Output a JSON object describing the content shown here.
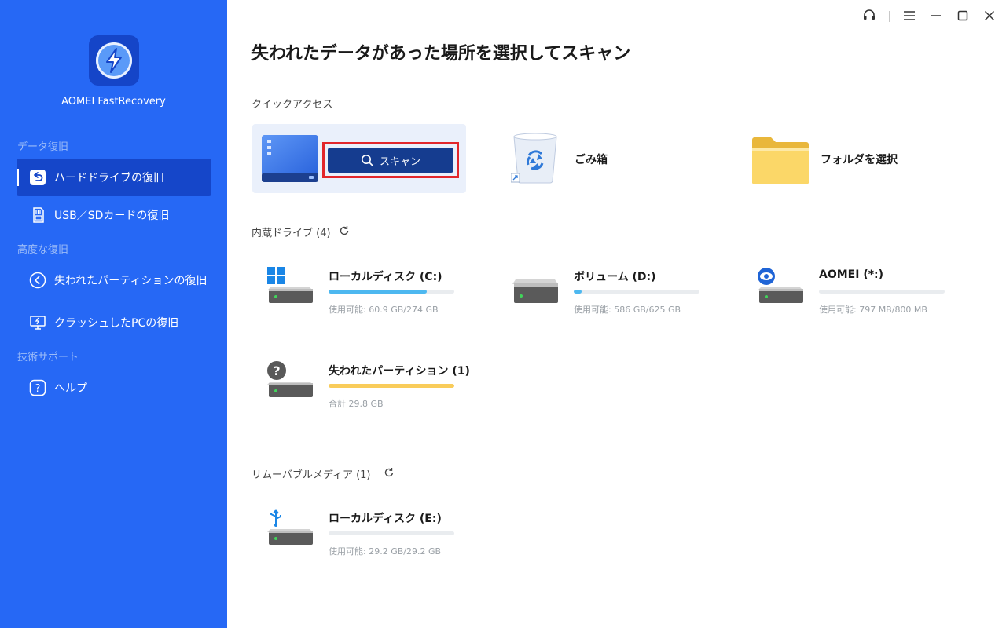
{
  "app": {
    "name": "AOMEI FastRecovery"
  },
  "sidebar": {
    "sections": {
      "data_recovery": "データ復旧",
      "advanced": "高度な復旧",
      "support": "技術サポート"
    },
    "items": [
      {
        "label": "ハードドライブの復旧",
        "icon": "undo-icon",
        "active": true
      },
      {
        "label": "USB／SDカードの復旧",
        "icon": "sd-card-icon",
        "active": false
      },
      {
        "label": "失われたパーティションの復旧",
        "icon": "partition-icon",
        "active": false
      },
      {
        "label": "クラッシュしたPCの復旧",
        "icon": "monitor-icon",
        "active": false
      },
      {
        "label": "ヘルプ",
        "icon": "help-icon",
        "active": false
      }
    ]
  },
  "main": {
    "title": "失われたデータがあった場所を選択してスキャン",
    "quick_access": {
      "label": "クイックアクセス",
      "scan_button": "スキャン",
      "recycle_bin": "ごみ箱",
      "select_folder": "フォルダを選択"
    },
    "internal": {
      "label": "内蔵ドライブ (4)",
      "drives": [
        {
          "name": "ローカルディスク (C:)",
          "info": "使用可能: 60.9 GB/274 GB",
          "usage": 0.78,
          "color": "#4db8f0",
          "badge": "windows-icon"
        },
        {
          "name": "ボリューム (D:)",
          "info": "使用可能: 586 GB/625 GB",
          "usage": 0.06,
          "color": "#4db8f0",
          "badge": "none"
        },
        {
          "name": "AOMEI (*:)",
          "info": "使用可能: 797 MB/800 MB",
          "usage": 0.0,
          "color": "#4db8f0",
          "badge": "eye-icon"
        },
        {
          "name": "失われたパーティション (1)",
          "info": "合計 29.8 GB",
          "usage": 1.0,
          "color": "#f9cc5a",
          "badge": "question-icon"
        }
      ]
    },
    "removable": {
      "label": "リムーバブルメディア (1)",
      "drives": [
        {
          "name": "ローカルディスク (E:)",
          "info": "使用可能: 29.2 GB/29.2 GB",
          "usage": 0.0,
          "color": "#4db8f0",
          "badge": "usb-icon"
        }
      ]
    }
  }
}
